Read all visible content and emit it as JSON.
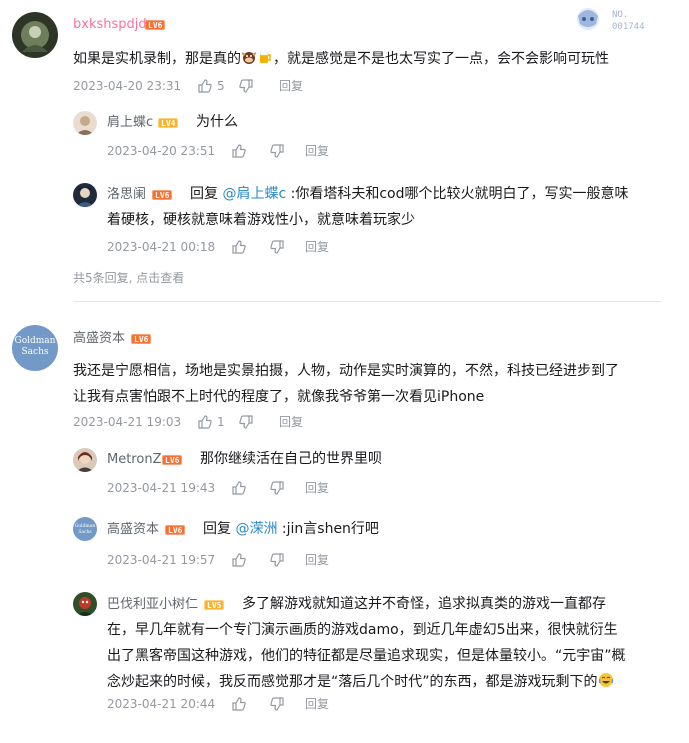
{
  "badge": {
    "text": "NO.\n001744",
    "line1": "NO.",
    "line2": "001744"
  },
  "threads": [
    {
      "user": "bxkshspdjd",
      "level": "LV6",
      "content_pre": "如果是实机录制，那是真的",
      "content_post": "，就是感觉是不是也太写实了一点，会不会影响可玩性",
      "time": "2023-04-20 23:31",
      "likes": "5",
      "reply_label": "回复",
      "replies": [
        {
          "user": "肩上蝶c",
          "level": "LV4",
          "content": "为什么",
          "time": "2023-04-20 23:51",
          "reply_label": "回复"
        },
        {
          "user": "洛思阑",
          "level": "LV6",
          "reply_word": "回复",
          "at": "@肩上蝶c",
          "content": " :你看塔科夫和cod哪个比较火就明白了，写实一般意味",
          "content_line2": "着硬核，硬核就意味着游戏性小，就意味着玩家少",
          "time": "2023-04-21 00:18",
          "reply_label": "回复"
        }
      ],
      "more": "共5条回复, 点击查看"
    },
    {
      "user": "高盛资本",
      "level": "LV6",
      "content_line1": "我还是宁愿相信，场地是实景拍摄，人物，动作是实时演算的，不然，科技已经进步到了",
      "content_line2": "让我有点害怕跟不上时代的程度了，就像我爷爷第一次看见iPhone",
      "time": "2023-04-21 19:03",
      "likes": "1",
      "reply_label": "回复",
      "replies": [
        {
          "user": "MetronZ",
          "level": "LV6",
          "content": "那你继续活在自己的世界里呗",
          "time": "2023-04-21 19:43",
          "reply_label": "回复"
        },
        {
          "user": "高盛资本",
          "level": "LV6",
          "reply_word": "回复",
          "at": "@溁洲",
          "content": " :jin言shen行吧",
          "time": "2023-04-21 19:57",
          "reply_label": "回复"
        },
        {
          "user": "巴伐利亚小树仁",
          "level": "LV5",
          "content_line1": "多了解游戏就知道这并不奇怪，追求拟真类的游戏一直都存",
          "content_line2": "在，早几年就有一个专门演示画质的游戏damo，到近几年虚幻5出来，很快就衍生",
          "content_line3": "出了黑客帝国这种游戏，他们的特征都是尽量追求现实，但是体量较小。“元宇宙”概",
          "content_line4": "念炒起来的时候，我反而感觉那才是“落后几个时代”的东西，都是游戏玩剩下的",
          "time": "2023-04-21 20:44",
          "reply_label": "回复"
        }
      ]
    }
  ],
  "colors": {
    "username": "#fb7299",
    "meta": "#9499a0",
    "link": "#2a88c9",
    "divider": "#e3e5e7"
  },
  "icons": [
    "like-icon",
    "dislike-icon",
    "cow-emoji",
    "beer-emoji",
    "laugh-cry-emoji"
  ],
  "avatar_text": {
    "goldman": "Goldman\nSachs"
  }
}
